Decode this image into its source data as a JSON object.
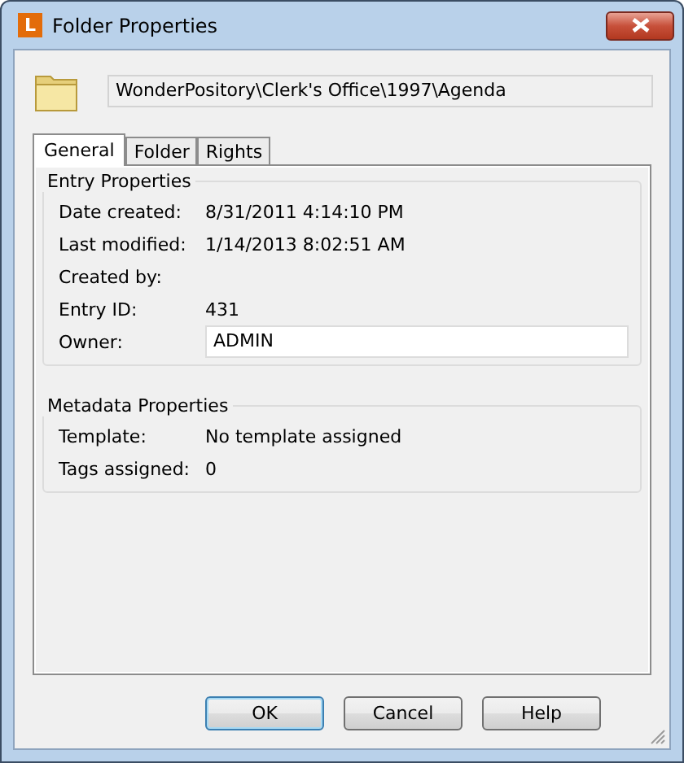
{
  "window": {
    "title": "Folder Properties",
    "app_letter": "L"
  },
  "path": "WonderPository\\Clerk's Office\\1997\\Agenda",
  "tabs": [
    {
      "label": "General",
      "selected": true
    },
    {
      "label": "Folder",
      "selected": false
    },
    {
      "label": "Rights",
      "selected": false
    }
  ],
  "groups": [
    {
      "title": "Entry Properties",
      "rows": [
        {
          "kind": "text",
          "label": "Date created:",
          "value": "8/31/2011 4:14:10 PM"
        },
        {
          "kind": "text",
          "label": "Last modified:",
          "value": "1/14/2013 8:02:51 AM"
        },
        {
          "kind": "text",
          "label": "Created by:"
        },
        {
          "kind": "text",
          "label": "Entry ID:",
          "value": "431"
        },
        {
          "kind": "field",
          "label": "Owner:",
          "value": "ADMIN"
        }
      ]
    },
    {
      "title": "Metadata Properties",
      "rows": [
        {
          "kind": "text",
          "label": "Template:",
          "value": "No template assigned"
        },
        {
          "kind": "text",
          "label": "Tags assigned:",
          "value": "0"
        }
      ]
    }
  ],
  "buttons": [
    {
      "label": "OK",
      "default": true
    },
    {
      "label": "Cancel",
      "default": false
    },
    {
      "label": "Help",
      "default": false
    }
  ]
}
